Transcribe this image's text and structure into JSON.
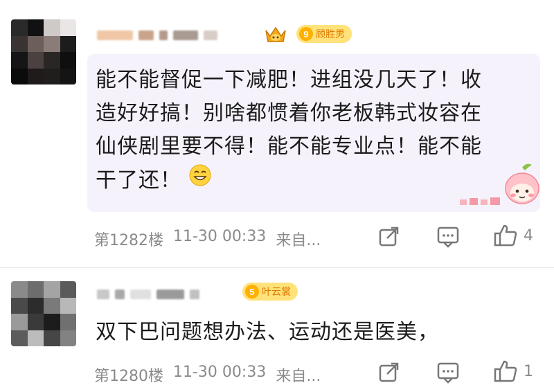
{
  "comments": [
    {
      "badge": {
        "level": "9",
        "name": "顾胜男"
      },
      "lines": [
        "能不能督促一下减肥！进组没几天了！收",
        "造好好搞！别啥都惯着你老板韩式妆容在",
        "仙侠剧里要不得！能不能专业点！能不能",
        "干了还！"
      ],
      "floor": "第1282楼",
      "time": "11-30 00:33",
      "source": "来自...",
      "likes": "4"
    },
    {
      "badge": {
        "level": "5",
        "name": "叶云裳"
      },
      "lines": [
        "双下巴问题想办法、运动还是医美，"
      ],
      "floor": "第1280楼",
      "time": "11-30 00:33",
      "source": "来自...",
      "likes": "1"
    }
  ],
  "icons": {
    "share": "share-icon",
    "comment": "comment-icon",
    "like": "thumbs-up-icon",
    "emoji": "grinning-emoji-icon",
    "sticker": "peach-sticker-icon",
    "vip": "crown-badge-icon"
  },
  "colors": {
    "bubble_bg": "#f6f2fb",
    "badge_bg": "#ffe27a",
    "meta_text": "#8a8a8a"
  }
}
